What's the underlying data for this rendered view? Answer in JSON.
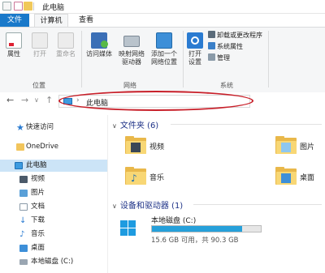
{
  "titlebar": {
    "title": "此电脑"
  },
  "tabs": [
    {
      "label": "文件"
    },
    {
      "label": "计算机"
    },
    {
      "label": "查看"
    }
  ],
  "ribbon": {
    "location_group": {
      "label": "位置",
      "buttons": [
        {
          "label": "属性",
          "icon": "properties-icon"
        },
        {
          "label": "打开",
          "icon": "open-icon"
        },
        {
          "label": "重命名",
          "icon": "rename-icon"
        }
      ]
    },
    "network_group": {
      "label": "网络",
      "buttons": [
        {
          "label": "访问媒体",
          "icon": "media-icon"
        },
        {
          "label": "映射网络",
          "label2": "驱动器",
          "icon": "map-drive-icon"
        },
        {
          "label": "添加一个",
          "label2": "网络位置",
          "icon": "add-network-location-icon"
        }
      ]
    },
    "system_group": {
      "label": "系统",
      "open_settings": {
        "label": "打开",
        "label2": "设置",
        "icon": "gear-icon"
      },
      "small_buttons": [
        {
          "label": "卸载或更改程序",
          "icon": "uninstall-icon"
        },
        {
          "label": "系统属性",
          "icon": "system-properties-icon"
        },
        {
          "label": "管理",
          "icon": "manage-icon"
        }
      ]
    }
  },
  "address": {
    "path": "此电脑"
  },
  "sidebar": {
    "items": [
      {
        "label": "快速访问",
        "icon": "star-icon"
      },
      {
        "label": "OneDrive",
        "icon": "onedrive-folder-icon"
      },
      {
        "label": "此电脑",
        "icon": "computer-icon"
      },
      {
        "label": "视频",
        "icon": "videos-icon"
      },
      {
        "label": "图片",
        "icon": "pictures-icon"
      },
      {
        "label": "文档",
        "icon": "documents-icon"
      },
      {
        "label": "下载",
        "icon": "downloads-icon"
      },
      {
        "label": "音乐",
        "icon": "music-icon"
      },
      {
        "label": "桌面",
        "icon": "desktop-icon"
      },
      {
        "label": "本地磁盘 (C:)",
        "icon": "drive-icon"
      }
    ]
  },
  "content": {
    "folders_header": "文件夹 (6)",
    "folders": [
      {
        "label": "视频",
        "icon": "videos-folder-icon"
      },
      {
        "label": "图片",
        "icon": "pictures-folder-icon"
      },
      {
        "label": "音乐",
        "icon": "music-folder-icon"
      },
      {
        "label": "桌面",
        "icon": "desktop-folder-icon"
      }
    ],
    "devices_header": "设备和驱动器 (1)",
    "drive": {
      "name": "本地磁盘 (C:)",
      "free_text": "15.6 GB 可用，共 90.3 GB",
      "used_fraction": 0.83
    }
  },
  "colors": {
    "accent": "#1979ca",
    "selection": "#cce4f7",
    "annotation_red": "#c8202a",
    "drive_bar": "#26a0da"
  }
}
